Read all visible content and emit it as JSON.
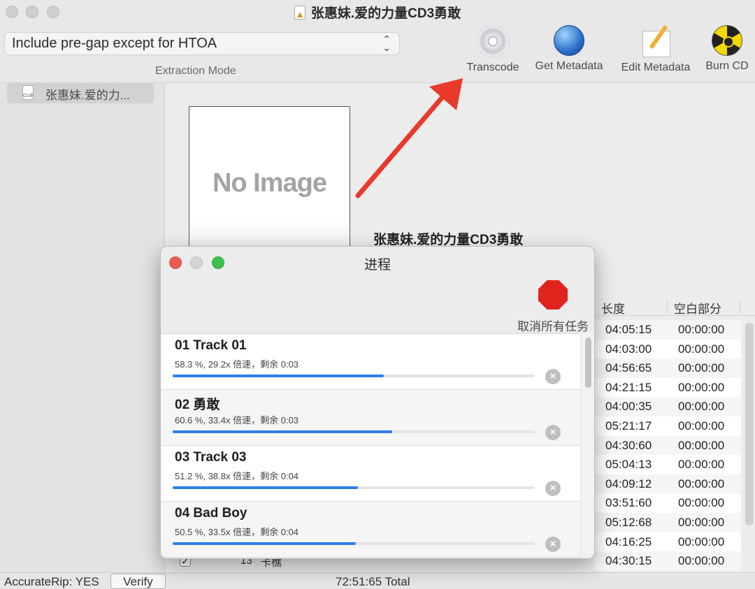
{
  "window": {
    "title": "张惠妹.爱的力量CD3勇敢"
  },
  "toolbar": {
    "extraction_mode_value": "Include pre-gap except for HTOA",
    "extraction_mode_label": "Extraction Mode",
    "items": [
      {
        "label": "Transcode",
        "icon": "cd-disc-icon"
      },
      {
        "label": "Get Metadata",
        "icon": "globe-icon"
      },
      {
        "label": "Edit Metadata",
        "icon": "pencil-paper-icon"
      },
      {
        "label": "Burn CD",
        "icon": "radioactive-icon"
      }
    ]
  },
  "sidebar": {
    "items": [
      {
        "label": "张惠妹.爱的力...",
        "icon": "cue-file-icon",
        "icon_text": "CUE"
      }
    ]
  },
  "main": {
    "cover_placeholder": "No Image",
    "album_title": "张惠妹.爱的力量CD3勇敢",
    "columns": [
      "长度",
      "空白部分"
    ],
    "rows": [
      {
        "length": "04:05:15",
        "gap": "00:00:00"
      },
      {
        "length": "04:03:00",
        "gap": "00:00:00"
      },
      {
        "length": "04:56:65",
        "gap": "00:00:00"
      },
      {
        "length": "04:21:15",
        "gap": "00:00:00"
      },
      {
        "length": "04:00:35",
        "gap": "00:00:00"
      },
      {
        "length": "05:21:17",
        "gap": "00:00:00"
      },
      {
        "length": "04:30:60",
        "gap": "00:00:00"
      },
      {
        "length": "05:04:13",
        "gap": "00:00:00"
      },
      {
        "length": "04:09:12",
        "gap": "00:00:00"
      },
      {
        "length": "03:51:60",
        "gap": "00:00:00"
      },
      {
        "length": "05:12:68",
        "gap": "00:00:00"
      },
      {
        "length": "04:16:25",
        "gap": "00:00:00"
      },
      {
        "length": "04:30:15",
        "gap": "00:00:00"
      }
    ],
    "partial_row": {
      "check": "✓",
      "number": "13",
      "title": "卡樵"
    }
  },
  "status": {
    "accuraterip": "AccurateRip: YES",
    "verify_label": "Verify",
    "total": "72:51:65 Total"
  },
  "progress_dialog": {
    "title": "进程",
    "cancel_all_label": "取消所有任务",
    "jobs": [
      {
        "name": "01 Track 01",
        "status": "58.3 %, 29.2x 倍速，剩余 0:03",
        "progress": 0.583
      },
      {
        "name": "02 勇敢",
        "status": "60.6 %, 33.4x 倍速，剩余 0:03",
        "progress": 0.606
      },
      {
        "name": "03 Track 03",
        "status": "51.2 %, 38.8x 倍速，剩余 0:04",
        "progress": 0.512
      },
      {
        "name": "04 Bad Boy",
        "status": "50.5 %, 33.5x 倍速，剩余 0:04",
        "progress": 0.505
      }
    ]
  },
  "colors": {
    "accent": "#2f7fe6",
    "stop": "#e0241d",
    "annotation_arrow": "#e8392a"
  }
}
